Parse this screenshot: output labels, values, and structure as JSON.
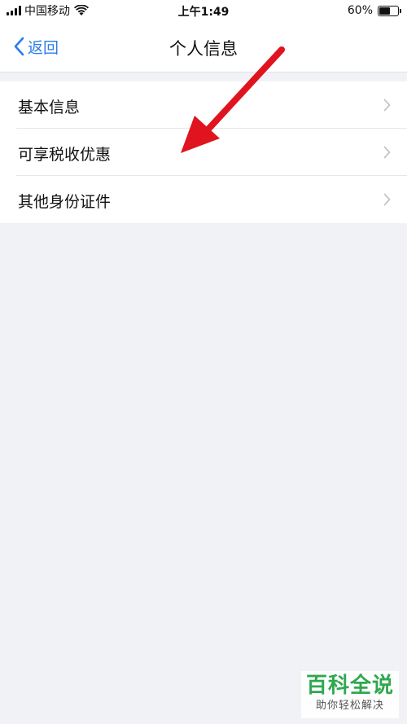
{
  "status_bar": {
    "carrier": "中国移动",
    "time": "上午1:49",
    "battery_percent_text": "60%",
    "battery_level": 0.6,
    "signal_bars": 4
  },
  "nav": {
    "back_label": "返回",
    "title": "个人信息"
  },
  "list": {
    "items": [
      {
        "label": "基本信息"
      },
      {
        "label": "可享税收优惠"
      },
      {
        "label": "其他身份证件"
      }
    ]
  },
  "watermark": {
    "title": "百科全说",
    "subtitle": "助你轻松解决"
  },
  "colors": {
    "accent": "#2b7ce9",
    "annotation_arrow": "#e0141e",
    "watermark_green": "#2fa84f",
    "background": "#f1f2f6"
  },
  "icons": [
    "signal-icon",
    "wifi-icon",
    "battery-icon",
    "back-chevron-icon",
    "chevron-right-icon"
  ]
}
